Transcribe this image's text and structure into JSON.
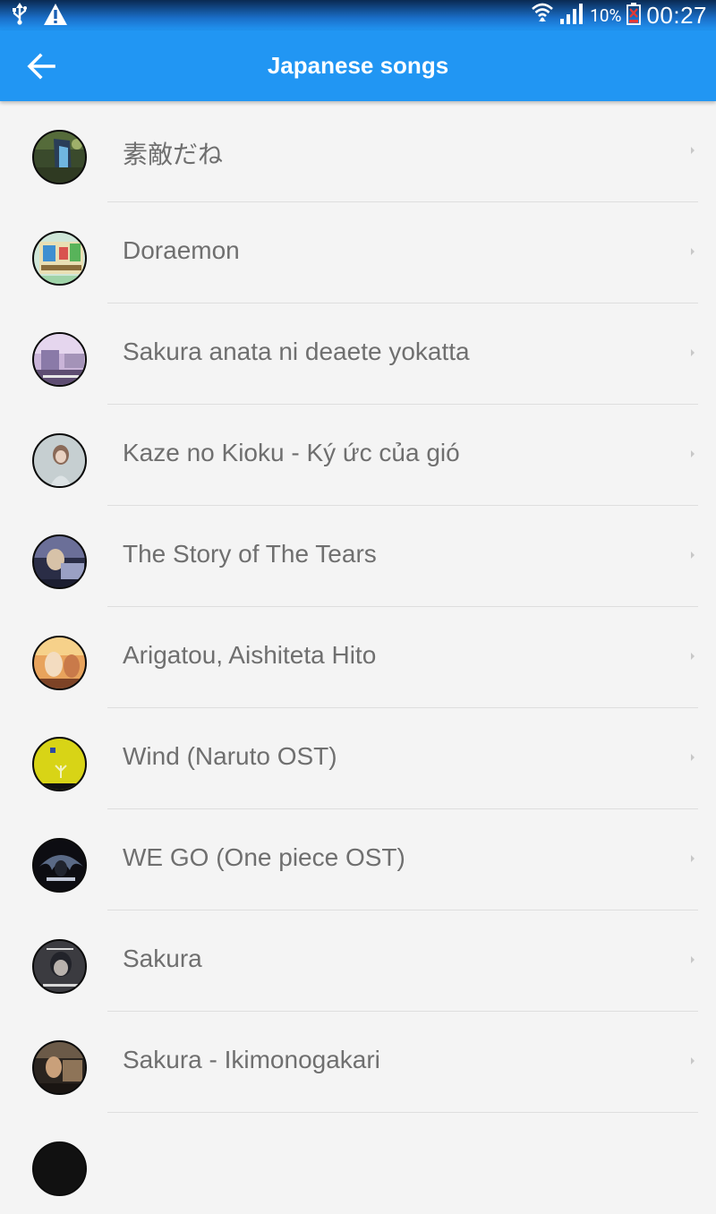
{
  "status_bar": {
    "battery_percent": "10%",
    "time": "00:27",
    "icons": [
      "usb-icon",
      "warning-icon",
      "wifi-icon",
      "signal-icon",
      "battery-icon"
    ]
  },
  "app_bar": {
    "title": "Japanese songs",
    "back_icon": "arrow-back-icon",
    "color": "#2196f3"
  },
  "songs": [
    {
      "title": "素敵だね"
    },
    {
      "title": "Doraemon"
    },
    {
      "title": "Sakura anata ni deaete yokatta"
    },
    {
      "title": "Kaze no Kioku - Ký ức của gió"
    },
    {
      "title": "The Story of The Tears"
    },
    {
      "title": "Arigatou, Aishiteta Hito"
    },
    {
      "title": "Wind (Naruto OST)"
    },
    {
      "title": "WE GO (One piece OST)"
    },
    {
      "title": "Sakura"
    },
    {
      "title": "Sakura - Ikimonogakari"
    }
  ]
}
